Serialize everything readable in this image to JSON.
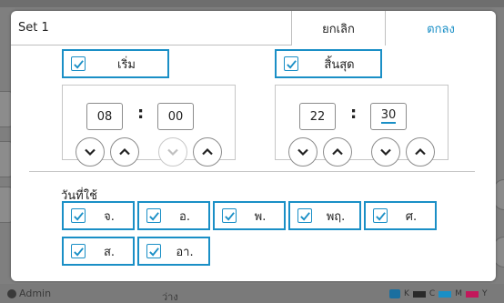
{
  "background": {
    "user_name": "Admin",
    "status_text": "ว่าง",
    "ink": [
      {
        "label": "K",
        "color": "#2a2a2a"
      },
      {
        "label": "C",
        "color": "#1a8fc6"
      },
      {
        "label": "M",
        "color": "#c2185b"
      },
      {
        "label": "Y",
        "color": "#e3c400"
      }
    ]
  },
  "dialog": {
    "title": "Set 1",
    "cancel_label": "ยกเลิก",
    "ok_label": "ตกลง"
  },
  "start": {
    "label": "เริ่ม",
    "checked": true,
    "hour": "08",
    "minute": "00",
    "minute_down_enabled": false
  },
  "end": {
    "label": "สิ้นสุด",
    "checked": true,
    "hour": "22",
    "minute": "30",
    "active_field": "minute"
  },
  "days_section_label": "วันที่ใช้",
  "days": [
    {
      "label": "จ.",
      "checked": true
    },
    {
      "label": "อ.",
      "checked": true
    },
    {
      "label": "พ.",
      "checked": true
    },
    {
      "label": "พฤ.",
      "checked": true
    },
    {
      "label": "ศ.",
      "checked": true
    },
    {
      "label": "ส.",
      "checked": true
    },
    {
      "label": "อา.",
      "checked": true
    }
  ],
  "colors": {
    "accent": "#1a8fc6",
    "ok_text": "#1a8fc6"
  }
}
